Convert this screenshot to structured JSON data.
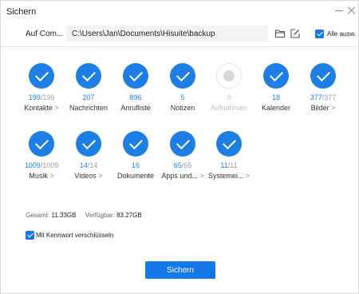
{
  "window": {
    "title": "Sichern"
  },
  "pathbar": {
    "label": "Auf Com...",
    "path": "C:\\Users\\Jan\\Documents\\Hisuite\\backup",
    "select_all_label": "Alle ausw."
  },
  "categories": [
    {
      "count": "199",
      "total": "/199",
      "label": "Kontakte",
      "arrow": ">",
      "checked": true
    },
    {
      "count": "207",
      "total": "",
      "label": "Nachrichten",
      "arrow": "",
      "checked": true
    },
    {
      "count": "896",
      "total": "",
      "label": "Anrufliste",
      "arrow": "",
      "checked": true
    },
    {
      "count": "5",
      "total": "",
      "label": "Notizen",
      "arrow": "",
      "checked": true
    },
    {
      "count": "0",
      "total": "",
      "label": "Aufnahmen",
      "arrow": "",
      "checked": false
    },
    {
      "count": "18",
      "total": "",
      "label": "Kalender",
      "arrow": "",
      "checked": true
    },
    {
      "count": "377",
      "total": "/377",
      "label": "Bilder",
      "arrow": ">",
      "checked": true
    },
    {
      "count": "1009",
      "total": "/1009",
      "label": "Musik",
      "arrow": ">",
      "checked": true
    },
    {
      "count": "14",
      "total": "/14",
      "label": "Videos",
      "arrow": ">",
      "checked": true
    },
    {
      "count": "16",
      "total": "",
      "label": "Dokumente",
      "arrow": "",
      "checked": true
    },
    {
      "count": "65",
      "total": "/65",
      "label": "Apps und...",
      "arrow": ">",
      "checked": true
    },
    {
      "count": "11",
      "total": "/11",
      "label": "Systemei...",
      "arrow": ">",
      "checked": true
    }
  ],
  "storage": {
    "total_label": "Gesamt:",
    "total_value": "11.33GB",
    "available_label": "Verfügbar:",
    "available_value": "83.27GB"
  },
  "encrypt": {
    "label": "Mit Kennwort verschlüsseln",
    "checked": true
  },
  "actions": {
    "primary_label": "Sichern"
  },
  "colors": {
    "accent": "#1478e8",
    "disabled_text": "#c4c4c4"
  }
}
